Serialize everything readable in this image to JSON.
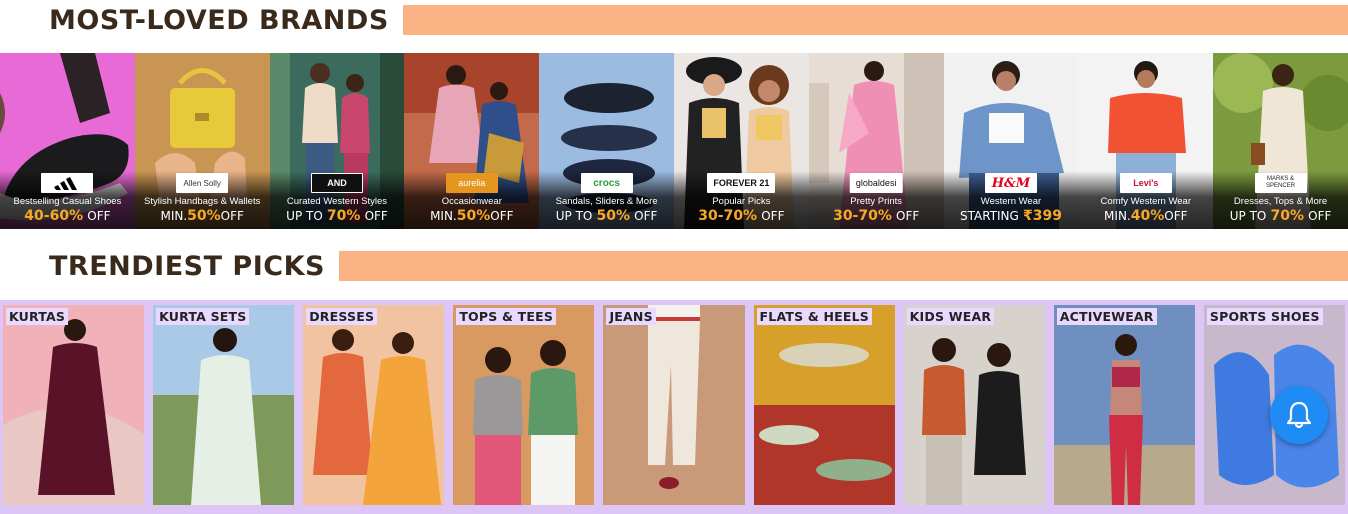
{
  "sections": {
    "brands_title": "MOST-LOVED BRANDS",
    "trend_title": "TRENDIEST PICKS"
  },
  "brands": [
    {
      "logo": "adidas",
      "caption": "Bestselling Casual Shoes",
      "pre": "",
      "highlight": "40-60%",
      "post": "OFF"
    },
    {
      "logo": "Allen Solly",
      "caption": "Stylish Handbags & Wallets",
      "pre": "MIN.",
      "highlight": "50%",
      "post": "OFF"
    },
    {
      "logo": "AND",
      "caption": "Curated Western Styles",
      "pre": "UP TO",
      "highlight": "70%",
      "post": "OFF"
    },
    {
      "logo": "aurelia",
      "caption": "Occasionwear",
      "pre": "MIN.",
      "highlight": "50%",
      "post": "OFF"
    },
    {
      "logo": "crocs",
      "caption": "Sandals, Sliders & More",
      "pre": "UP TO",
      "highlight": "50%",
      "post": "OFF"
    },
    {
      "logo": "FOREVER 21",
      "caption": "Popular Picks",
      "pre": "",
      "highlight": "30-70%",
      "post": "OFF"
    },
    {
      "logo": "globaldesi",
      "caption": "Pretty Prints",
      "pre": "",
      "highlight": "30-70%",
      "post": "OFF"
    },
    {
      "logo": "H&M",
      "caption": "Western Wear",
      "pre": "STARTING",
      "highlight": "₹399",
      "post": ""
    },
    {
      "logo": "Levi's",
      "caption": "Comfy Western Wear",
      "pre": "MIN.",
      "highlight": "40%",
      "post": "OFF"
    },
    {
      "logo": "MARKS & SPENCER",
      "caption": "Dresses, Tops & More",
      "pre": "UP TO",
      "highlight": "70%",
      "post": "OFF"
    }
  ],
  "trends": [
    {
      "label": "KURTAS"
    },
    {
      "label": "KURTA SETS"
    },
    {
      "label": "DRESSES"
    },
    {
      "label": "TOPS & TEES"
    },
    {
      "label": "JEANS"
    },
    {
      "label": "FLATS & HEELS"
    },
    {
      "label": "KIDS WEAR"
    },
    {
      "label": "ACTIVEWEAR"
    },
    {
      "label": "SPORTS SHOES"
    }
  ],
  "icons": {
    "notification": "bell-icon"
  },
  "colors": {
    "accent_bar": "#fbb386",
    "offer_highlight": "#f9a826",
    "trend_background": "#ddc6f5",
    "bell_button": "#1f8bf4"
  }
}
